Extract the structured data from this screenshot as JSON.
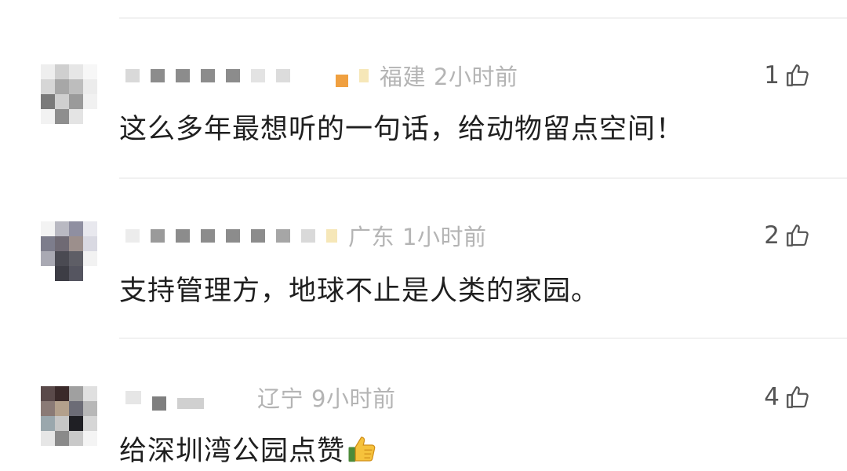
{
  "comments": [
    {
      "location": "福建",
      "time": "2小时前",
      "text": "这么多年最想听的一句话，给动物留点空间！",
      "likes": "1"
    },
    {
      "location": "广东",
      "time": "1小时前",
      "text": "支持管理方，地球不止是人类的家园。",
      "likes": "2"
    },
    {
      "location": "辽宁",
      "time": "9小时前",
      "text": "给深圳湾公园点赞",
      "likes": "4"
    }
  ],
  "icons": {
    "like": "thumb-up-outline-icon",
    "emoji": "thumbs-up-emoji-icon"
  },
  "colors": {
    "meta_text": "#b4b4b4",
    "body_text": "#1f1f1f",
    "like_count": "#555555",
    "divider": "#f1f1f1"
  }
}
